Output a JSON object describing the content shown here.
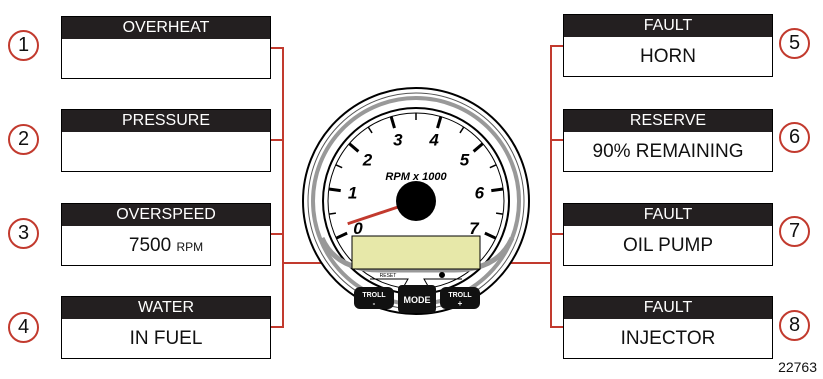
{
  "panels": [
    {
      "num": "1",
      "title": "OVERHEAT",
      "value": "",
      "unit": ""
    },
    {
      "num": "2",
      "title": "PRESSURE",
      "value": "",
      "unit": ""
    },
    {
      "num": "3",
      "title": "OVERSPEED",
      "value": "7500",
      "unit": "RPM"
    },
    {
      "num": "4",
      "title": "WATER",
      "value": "IN FUEL",
      "unit": ""
    },
    {
      "num": "5",
      "title": "FAULT",
      "value": "HORN",
      "unit": ""
    },
    {
      "num": "6",
      "title": "RESERVE",
      "value": "90% REMAINING",
      "unit": ""
    },
    {
      "num": "7",
      "title": "FAULT",
      "value": "OIL PUMP",
      "unit": ""
    },
    {
      "num": "8",
      "title": "FAULT",
      "value": "INJECTOR",
      "unit": ""
    }
  ],
  "gauge": {
    "label": "RPM x 1000",
    "ticks": [
      "0",
      "1",
      "2",
      "3",
      "4",
      "5",
      "6",
      "7"
    ],
    "needle_value": 0.2,
    "buttons": {
      "troll_minus_a": "TROLL",
      "troll_minus_b": "-",
      "mode": "MODE",
      "troll_plus_a": "TROLL",
      "troll_plus_b": "+",
      "reset": "RESET"
    }
  },
  "colors": {
    "connector": "#c23a2e",
    "lcd": "#e7e8a9",
    "header": "#231f20"
  },
  "figure_number": "22763"
}
